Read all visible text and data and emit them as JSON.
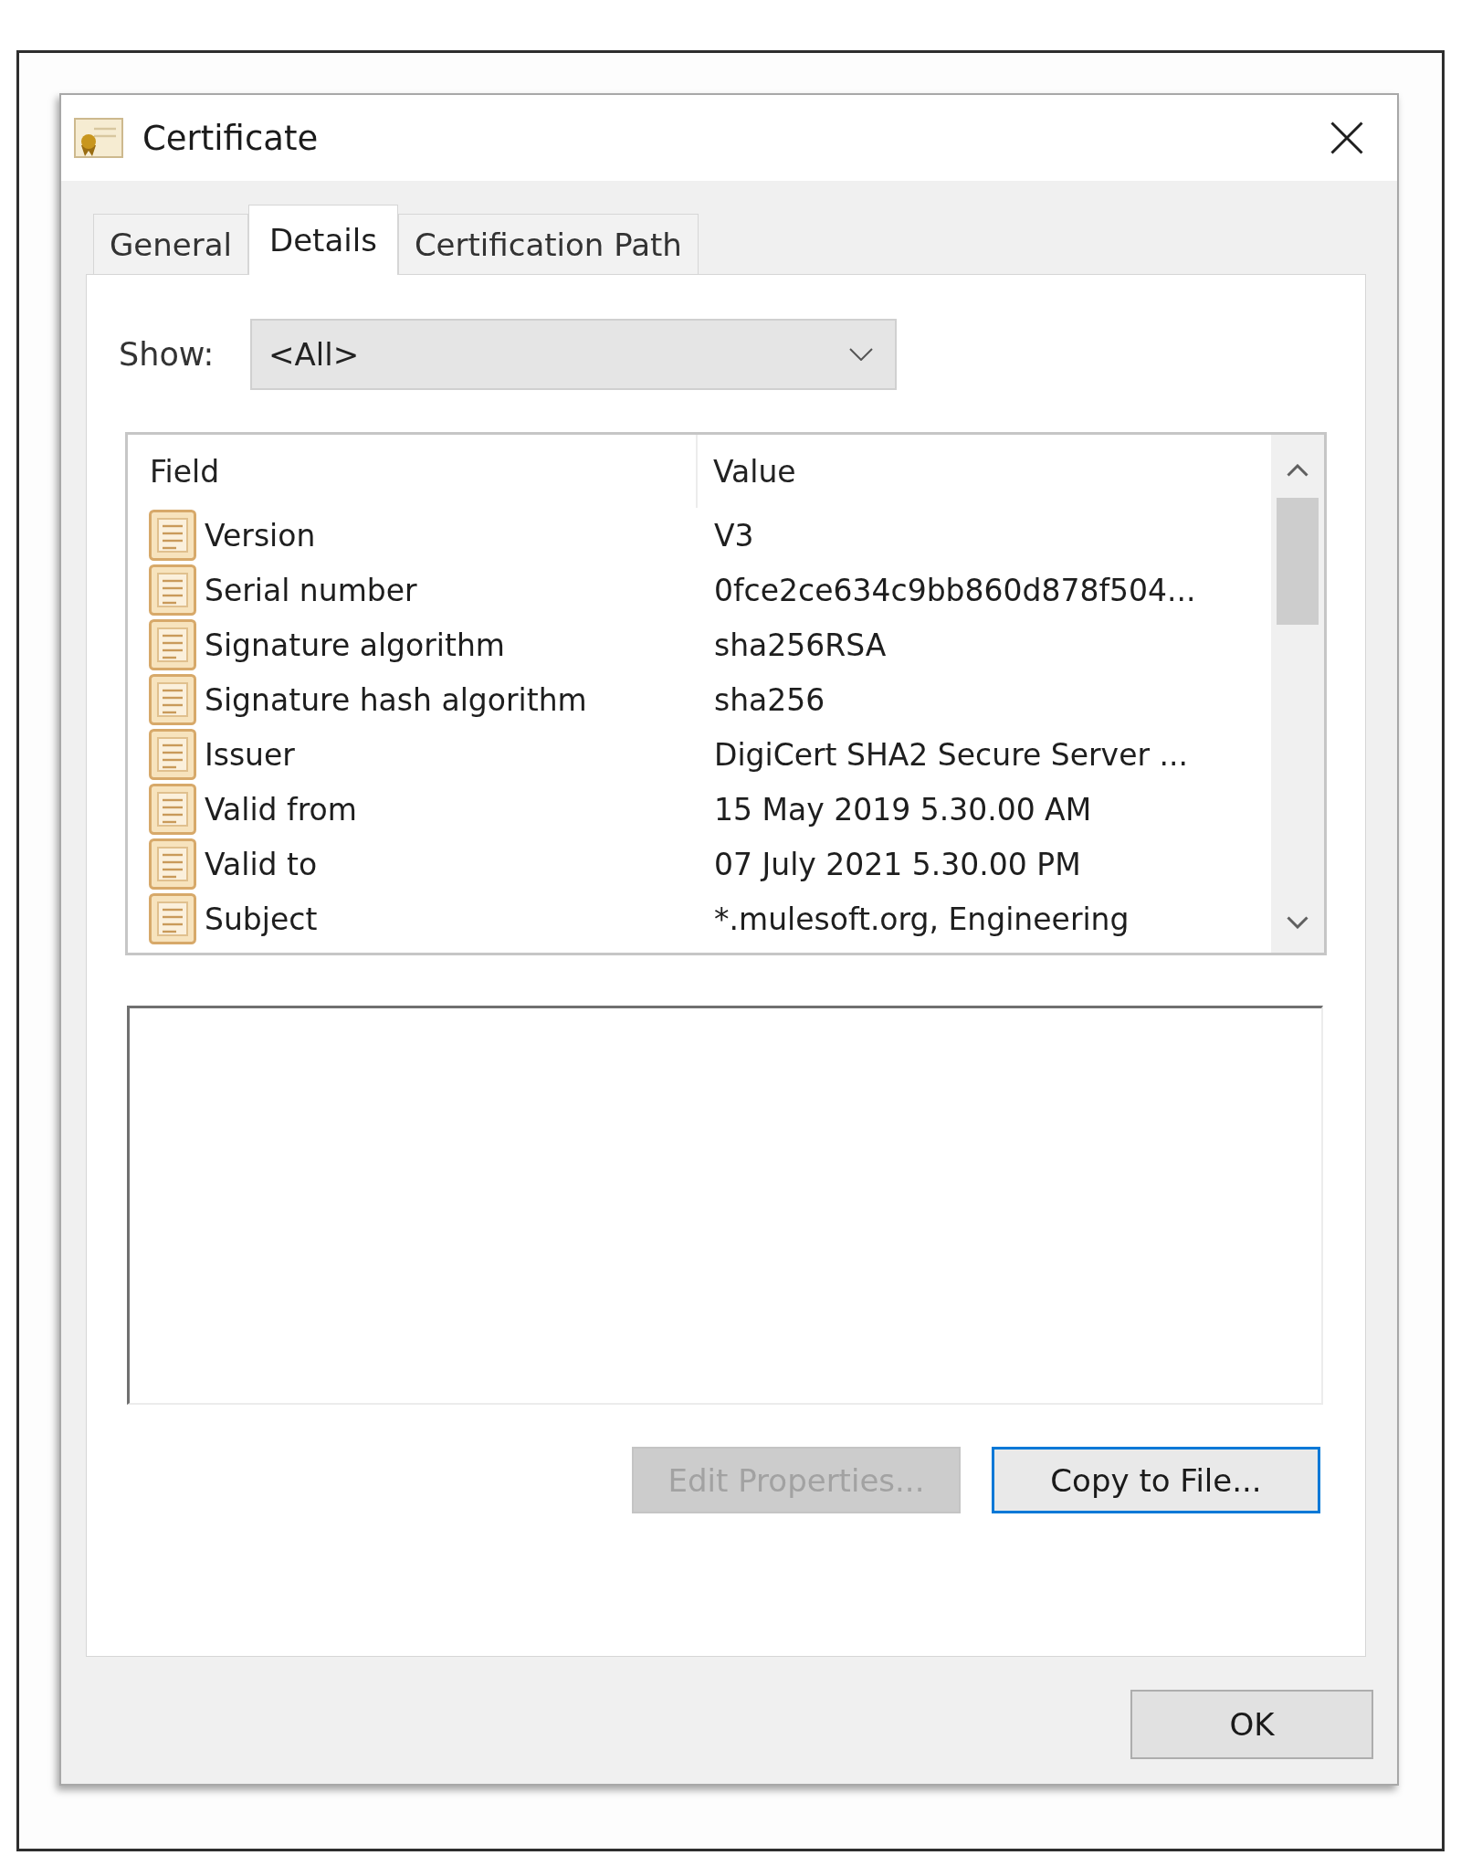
{
  "window": {
    "title": "Certificate"
  },
  "tabs": [
    {
      "label": "General",
      "selected": false
    },
    {
      "label": "Details",
      "selected": true
    },
    {
      "label": "Certification Path",
      "selected": false
    }
  ],
  "show": {
    "label": "Show:",
    "value": "<All>"
  },
  "table": {
    "columns": [
      "Field",
      "Value"
    ],
    "rows": [
      {
        "field": "Version",
        "value": "V3"
      },
      {
        "field": "Serial number",
        "value": "0fce2ce634c9bb860d878f504..."
      },
      {
        "field": "Signature algorithm",
        "value": "sha256RSA"
      },
      {
        "field": "Signature hash algorithm",
        "value": "sha256"
      },
      {
        "field": "Issuer",
        "value": "DigiCert SHA2 Secure Server ..."
      },
      {
        "field": "Valid from",
        "value": "15 May 2019 5.30.00 AM"
      },
      {
        "field": "Valid to",
        "value": "07 July 2021 5.30.00 PM"
      },
      {
        "field": "Subject",
        "value": "*.mulesoft.org, Engineering"
      }
    ]
  },
  "actions": [
    {
      "label": "Edit Properties...",
      "disabled": true,
      "focused": false
    },
    {
      "label": "Copy to File...",
      "disabled": false,
      "focused": true
    }
  ],
  "dialog_buttons": [
    {
      "label": "OK"
    }
  ]
}
